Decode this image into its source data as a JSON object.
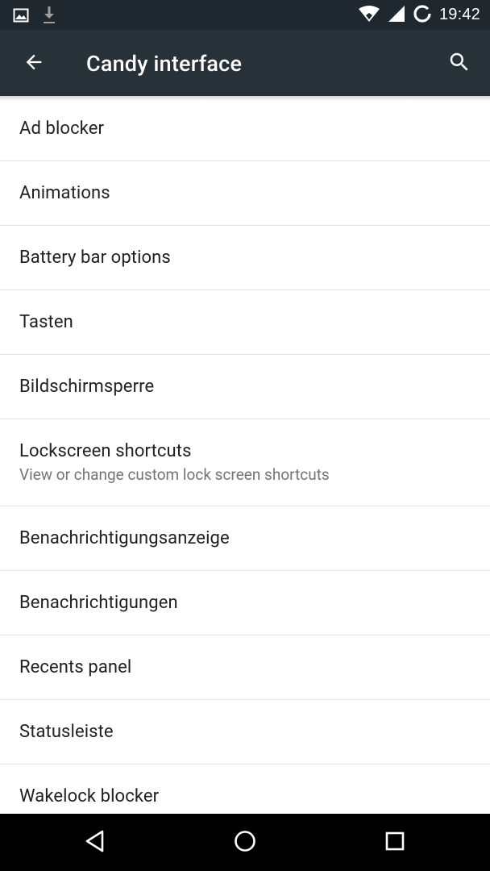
{
  "status_bar": {
    "time": "19:42",
    "icons": [
      "image-icon",
      "download-icon",
      "wifi-icon",
      "signal-icon",
      "sync-ring-icon"
    ]
  },
  "app_bar": {
    "title": "Candy interface",
    "back_icon": "arrow-back-icon",
    "search_icon": "search-icon"
  },
  "settings": {
    "items": [
      {
        "label": "Ad blocker"
      },
      {
        "label": "Animations"
      },
      {
        "label": "Battery bar options"
      },
      {
        "label": "Tasten"
      },
      {
        "label": "Bildschirmsperre"
      },
      {
        "label": "Lockscreen shortcuts",
        "summary": "View or change custom lock screen shortcuts"
      },
      {
        "label": "Benachrichtigungsanzeige"
      },
      {
        "label": "Benachrichtigungen"
      },
      {
        "label": "Recents panel"
      },
      {
        "label": "Statusleiste"
      },
      {
        "label": "Wakelock blocker"
      }
    ]
  },
  "nav_bar": {
    "icons": [
      "back-triangle-icon",
      "home-circle-icon",
      "recents-square-icon"
    ]
  },
  "colors": {
    "status_bar_bg": "#1e282e",
    "app_bar_bg": "#263238",
    "text_primary": "#212121",
    "text_secondary": "#757575",
    "divider": "#e3e3e3"
  }
}
